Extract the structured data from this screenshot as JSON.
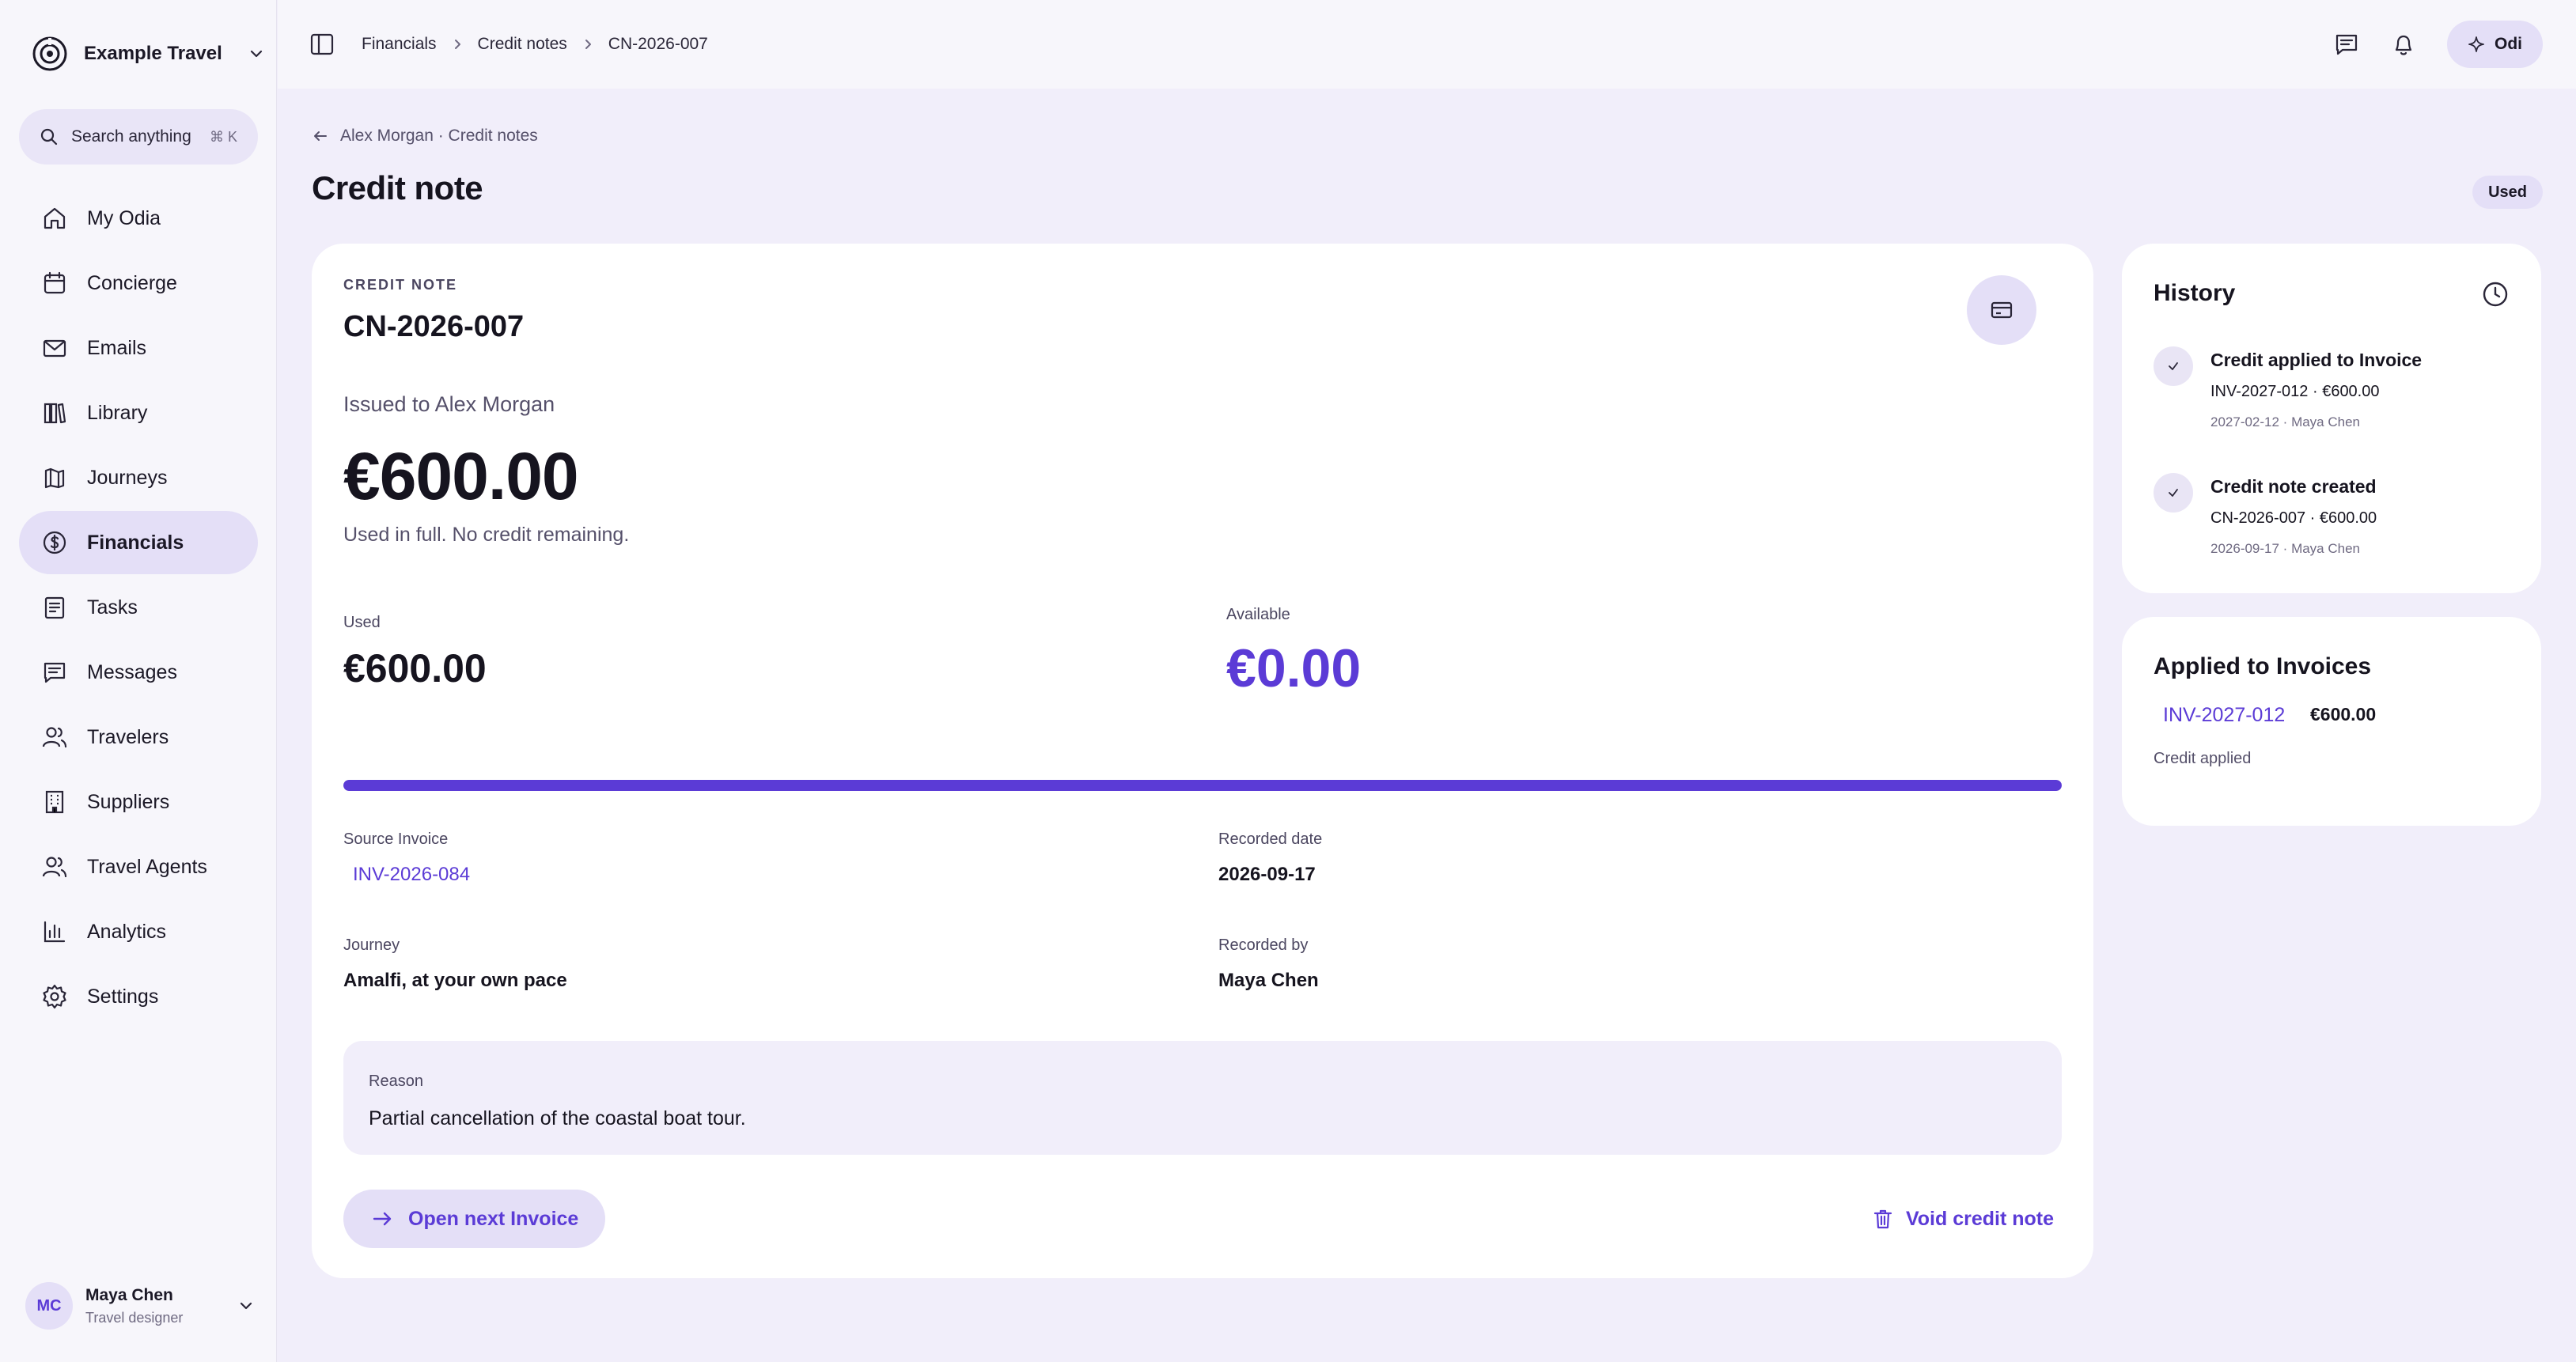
{
  "brand": {
    "name": "Example Travel"
  },
  "search": {
    "label": "Search anything",
    "shortcut": "⌘ K"
  },
  "nav": [
    {
      "label": "My Odia",
      "icon": "home-icon"
    },
    {
      "label": "Concierge",
      "icon": "calendar-icon"
    },
    {
      "label": "Emails",
      "icon": "mail-icon"
    },
    {
      "label": "Library",
      "icon": "library-icon"
    },
    {
      "label": "Journeys",
      "icon": "journeys-icon"
    },
    {
      "label": "Financials",
      "icon": "dollar-circle-icon",
      "active": true
    },
    {
      "label": "Tasks",
      "icon": "tasks-icon"
    },
    {
      "label": "Messages",
      "icon": "message-icon"
    },
    {
      "label": "Travelers",
      "icon": "users-icon"
    },
    {
      "label": "Suppliers",
      "icon": "building-icon"
    },
    {
      "label": "Travel Agents",
      "icon": "agents-icon"
    },
    {
      "label": "Analytics",
      "icon": "bar-chart-icon"
    },
    {
      "label": "Settings",
      "icon": "gear-icon"
    }
  ],
  "user": {
    "initials": "MC",
    "name": "Maya Chen",
    "role": "Travel designer"
  },
  "topbar": {
    "breadcrumb": [
      "Financials",
      "Credit notes",
      "CN-2026-007"
    ],
    "assistant_label": "Odi"
  },
  "page": {
    "back_label": "Alex Morgan · Credit notes",
    "title": "Credit note",
    "status": "Used"
  },
  "credit_note": {
    "eyebrow": "CREDIT NOTE",
    "number": "CN-2026-007",
    "issued_to": "Issued to Alex Morgan",
    "amount": "€600.00",
    "amount_note": "Used in full. No credit remaining.",
    "used_label": "Used",
    "used_value": "€600.00",
    "available_label": "Available",
    "available_value": "€0.00",
    "used_fraction": 1.0,
    "source_invoice_label": "Source Invoice",
    "source_invoice": "INV-2026-084",
    "recorded_date_label": "Recorded date",
    "recorded_date": "2026-09-17",
    "journey_label": "Journey",
    "journey": "Amalfi, at your own pace",
    "recorded_by_label": "Recorded by",
    "recorded_by": "Maya Chen",
    "reason_label": "Reason",
    "reason": "Partial cancellation of the coastal boat tour.",
    "next_button": "Open next Invoice",
    "void_button": "Void credit note"
  },
  "history": {
    "title": "History",
    "events": [
      {
        "title": "Credit applied to Invoice",
        "detail": "INV-2027-012 · €600.00",
        "meta": "2027-02-12 · Maya Chen"
      },
      {
        "title": "Credit note created",
        "detail": "CN-2026-007 · €600.00",
        "meta": "2026-09-17 · Maya Chen"
      }
    ]
  },
  "applied": {
    "title": "Applied to Invoices",
    "invoice": "INV-2027-012",
    "amount": "€600.00",
    "status": "Credit applied"
  },
  "colors": {
    "accent": "#5b3bd6",
    "accent_soft": "#e4dff7",
    "background": "#f1eefa"
  }
}
